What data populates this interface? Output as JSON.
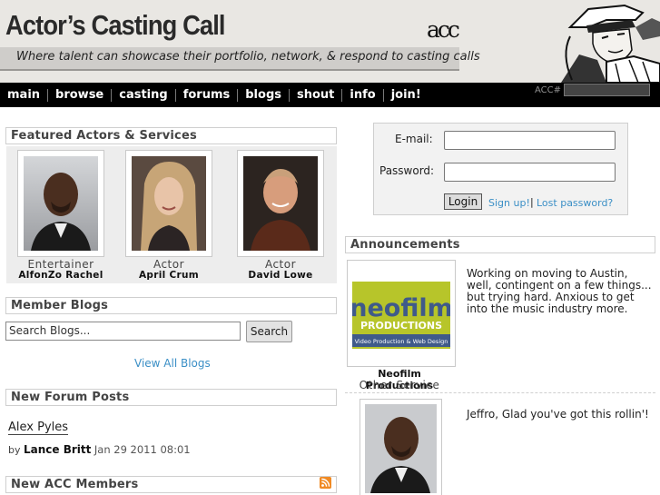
{
  "header": {
    "site_title": "Actor’s Casting Call",
    "logo_text": "acc",
    "tagline": "Where talent can showcase their portfolio, network, & respond to casting calls"
  },
  "nav": {
    "items": [
      "main",
      "browse",
      "casting",
      "forums",
      "blogs",
      "shout",
      "info",
      "join!"
    ],
    "acc_label": "ACC#",
    "acc_value": ""
  },
  "featured": {
    "heading": "Featured Actors & Services",
    "cards": [
      {
        "role": "Entertainer",
        "name": "AlfonZo Rachel"
      },
      {
        "role": "Actor",
        "name": "April Crum"
      },
      {
        "role": "Actor",
        "name": "David Lowe"
      }
    ]
  },
  "blogs": {
    "heading": "Member Blogs",
    "search_placeholder": "Search Blogs...",
    "search_button": "Search",
    "view_all": "View All Blogs"
  },
  "forum": {
    "heading": "New Forum Posts",
    "post_title": "Alex Pyles",
    "by": "by",
    "author": "Lance Britt",
    "date": "Jan 29 2011 08:01"
  },
  "members": {
    "heading": "New ACC Members"
  },
  "login": {
    "email_label": "E-mail:",
    "password_label": "Password:",
    "login_button": "Login",
    "signup_link": "Sign up!",
    "separator": "|",
    "lost_password_link": "Lost password?"
  },
  "announcements": {
    "heading": "Announcements",
    "items": [
      {
        "logo_line1": "neofilm",
        "logo_line2": "PRODUCTIONS",
        "logo_line3": "Video Production & Web Design",
        "name": "Neofilm Productions",
        "role": "Other Service",
        "text": "Working on moving to Austin, well, contingent on a few things... but trying hard. Anxious to get into the music industry more."
      },
      {
        "text": "Jeffro, Glad you've got this rollin'!"
      }
    ]
  },
  "colors": {
    "nav_bg": "#000000",
    "link": "#3b8fc6",
    "header_bg": "#e9e7e3",
    "logo_green": "#b7c52a",
    "logo_blue": "#3f5a8a",
    "rss": "#f08a24"
  }
}
